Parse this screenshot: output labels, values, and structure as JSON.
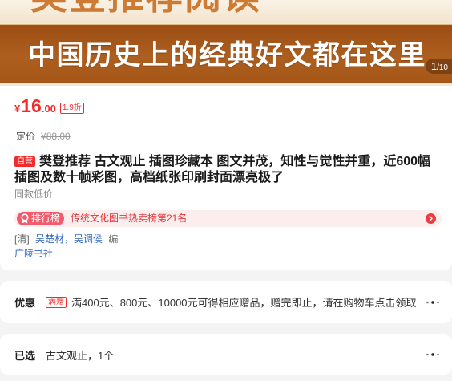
{
  "banner": {
    "headline": "樊登推荐阅读",
    "tagline": "中国历史上的经典好文都在这里",
    "indicator": {
      "current": "1",
      "separator": "/",
      "total": "10"
    }
  },
  "price": {
    "currency": "¥",
    "integer": "16",
    "decimal": ".00",
    "discount": "1.9折"
  },
  "list_price": {
    "label": "定价",
    "value": "¥88.00"
  },
  "title": {
    "badge": "自营",
    "lines": [
      "樊登推荐 古文观止 插图珍藏本 图文并茂，知性与觉性并重，近600幅",
      "插图及数十帧彩图，高档纸张印刷封面漂亮极了"
    ]
  },
  "low_price_note": "同款低价",
  "ranking": {
    "badge": "排行榜",
    "text": "传统文化图书热卖榜第21名"
  },
  "authors": {
    "dynasty": "[清]",
    "names": [
      "吴楚材",
      "吴调侯"
    ],
    "separator": "，",
    "role": "编"
  },
  "publisher": "广陵书社",
  "promotion": {
    "label": "优惠",
    "badge": "满赠",
    "text": "满400元、800元、10000元可得相应赠品，赠完即止，请在购物车点击领取"
  },
  "selected": {
    "label": "已选",
    "value": "古文观止，1个"
  },
  "icons": {
    "ranking": "medal-icon",
    "ranking_arrow": "chevron-right-circle-icon",
    "more": "more-dots-icon"
  },
  "colors": {
    "price_red": "#f52a2a",
    "link_blue": "#3567c0",
    "banner_brown": "#ad5f1f",
    "headline_orange": "#cd7a33",
    "rank_pink": "#fdeeee",
    "rank_badge": "#f25b6c"
  }
}
